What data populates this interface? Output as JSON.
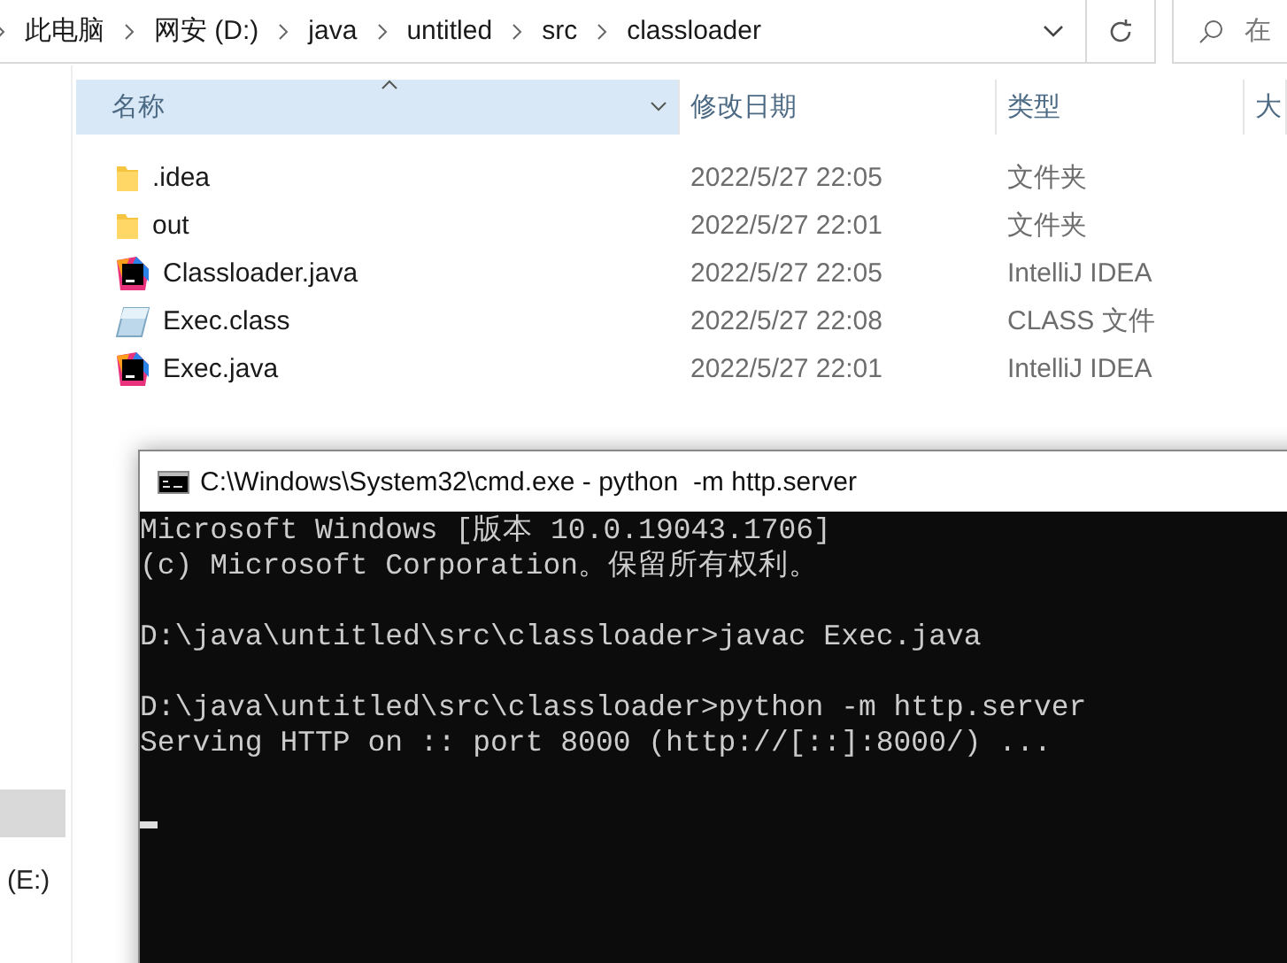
{
  "explorer": {
    "breadcrumb": [
      "此电脑",
      "网安 (D:)",
      "java",
      "untitled",
      "src",
      "classloader"
    ],
    "search": {
      "placeholder": "在"
    },
    "columns": [
      {
        "label": "名称",
        "selected": true
      },
      {
        "label": "修改日期",
        "selected": false
      },
      {
        "label": "类型",
        "selected": false
      },
      {
        "label": "大",
        "selected": false
      }
    ],
    "files": [
      {
        "name": ".idea",
        "modified": "2022/5/27 22:05",
        "type": "文件夹",
        "kind": "folder"
      },
      {
        "name": "out",
        "modified": "2022/5/27 22:01",
        "type": "文件夹",
        "kind": "folder"
      },
      {
        "name": "Classloader.java",
        "modified": "2022/5/27 22:05",
        "type": "IntelliJ IDEA",
        "kind": "intellij"
      },
      {
        "name": "Exec.class",
        "modified": "2022/5/27 22:08",
        "type": "CLASS 文件",
        "kind": "class"
      },
      {
        "name": "Exec.java",
        "modified": "2022/5/27 22:01",
        "type": "IntelliJ IDEA",
        "kind": "intellij"
      }
    ],
    "sidebar": {
      "items": [
        {
          "selected": true
        },
        {
          "label": "(E:)",
          "selected": false
        }
      ]
    }
  },
  "terminal": {
    "title": "C:\\Windows\\System32\\cmd.exe - python  -m http.server",
    "lines": [
      {
        "kind": "text",
        "text": "Microsoft Windows [版本 10.0.19043.1706]"
      },
      {
        "kind": "text",
        "text": "(c) Microsoft Corporation。保留所有权利。"
      },
      {
        "kind": "blank"
      },
      {
        "kind": "text",
        "text": "D:\\java\\untitled\\src\\classloader>javac Exec.java"
      },
      {
        "kind": "blank"
      },
      {
        "kind": "text",
        "text": "D:\\java\\untitled\\src\\classloader>python -m http.server"
      },
      {
        "kind": "text",
        "text": "Serving HTTP on :: port 8000 (http://[::]:8000/) ..."
      },
      {
        "kind": "blank"
      },
      {
        "kind": "cursor"
      }
    ]
  }
}
